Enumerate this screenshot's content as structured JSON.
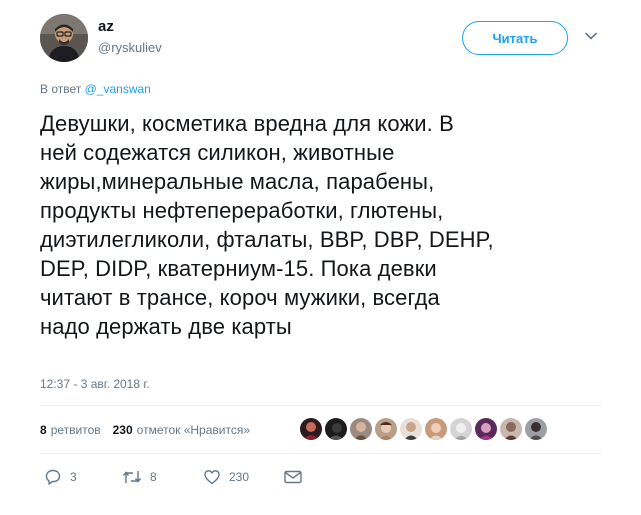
{
  "user": {
    "name": "az",
    "handle": "@ryskuliev"
  },
  "follow": {
    "label": "Читать"
  },
  "reply_to": {
    "prefix": "В ответ",
    "target": "@_vanswan"
  },
  "tweet": {
    "lines": [
      "Девушки, косметика вредна для кожи. В",
      "ней содежатся силикон, животные",
      "жиры,минеральные масла, парабены,",
      "продукты нефтепереработки, глютены,",
      "диэтилегликоли, фталаты, BBP, DBP, DEHP,",
      "DEP, DIDP, кватерниум-15. Пока девки",
      "читают в трансе, короч мужики, всегда",
      "надо держать две карты"
    ]
  },
  "timestamp": "12:37 - 3 авг. 2018 г.",
  "stats": {
    "retweets_count": "8",
    "retweets_label": "ретвитов",
    "likes_count": "230",
    "likes_label": "отметок «Нравится»"
  },
  "likers_count": 10,
  "actions": {
    "reply_count": "3",
    "retweet_count": "8",
    "like_count": "230"
  },
  "colors": {
    "accent": "#1da1f2",
    "muted": "#657786",
    "text": "#14171a",
    "divider": "#e6ecf0"
  }
}
